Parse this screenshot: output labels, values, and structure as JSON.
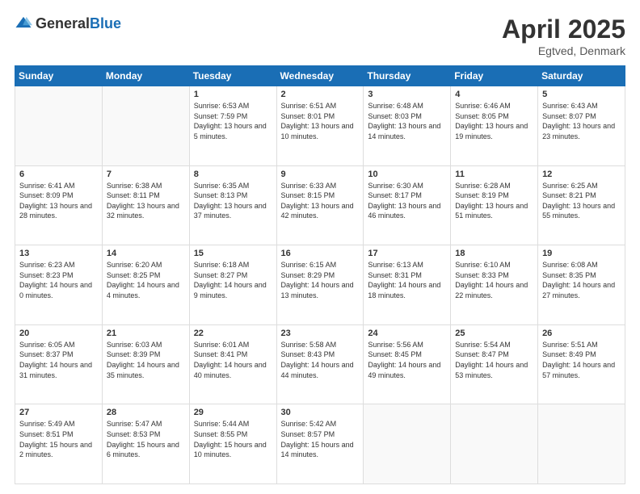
{
  "header": {
    "logo_general": "General",
    "logo_blue": "Blue",
    "title": "April 2025",
    "location": "Egtved, Denmark"
  },
  "days_of_week": [
    "Sunday",
    "Monday",
    "Tuesday",
    "Wednesday",
    "Thursday",
    "Friday",
    "Saturday"
  ],
  "weeks": [
    [
      {
        "num": "",
        "info": ""
      },
      {
        "num": "",
        "info": ""
      },
      {
        "num": "1",
        "info": "Sunrise: 6:53 AM\nSunset: 7:59 PM\nDaylight: 13 hours and 5 minutes."
      },
      {
        "num": "2",
        "info": "Sunrise: 6:51 AM\nSunset: 8:01 PM\nDaylight: 13 hours and 10 minutes."
      },
      {
        "num": "3",
        "info": "Sunrise: 6:48 AM\nSunset: 8:03 PM\nDaylight: 13 hours and 14 minutes."
      },
      {
        "num": "4",
        "info": "Sunrise: 6:46 AM\nSunset: 8:05 PM\nDaylight: 13 hours and 19 minutes."
      },
      {
        "num": "5",
        "info": "Sunrise: 6:43 AM\nSunset: 8:07 PM\nDaylight: 13 hours and 23 minutes."
      }
    ],
    [
      {
        "num": "6",
        "info": "Sunrise: 6:41 AM\nSunset: 8:09 PM\nDaylight: 13 hours and 28 minutes."
      },
      {
        "num": "7",
        "info": "Sunrise: 6:38 AM\nSunset: 8:11 PM\nDaylight: 13 hours and 32 minutes."
      },
      {
        "num": "8",
        "info": "Sunrise: 6:35 AM\nSunset: 8:13 PM\nDaylight: 13 hours and 37 minutes."
      },
      {
        "num": "9",
        "info": "Sunrise: 6:33 AM\nSunset: 8:15 PM\nDaylight: 13 hours and 42 minutes."
      },
      {
        "num": "10",
        "info": "Sunrise: 6:30 AM\nSunset: 8:17 PM\nDaylight: 13 hours and 46 minutes."
      },
      {
        "num": "11",
        "info": "Sunrise: 6:28 AM\nSunset: 8:19 PM\nDaylight: 13 hours and 51 minutes."
      },
      {
        "num": "12",
        "info": "Sunrise: 6:25 AM\nSunset: 8:21 PM\nDaylight: 13 hours and 55 minutes."
      }
    ],
    [
      {
        "num": "13",
        "info": "Sunrise: 6:23 AM\nSunset: 8:23 PM\nDaylight: 14 hours and 0 minutes."
      },
      {
        "num": "14",
        "info": "Sunrise: 6:20 AM\nSunset: 8:25 PM\nDaylight: 14 hours and 4 minutes."
      },
      {
        "num": "15",
        "info": "Sunrise: 6:18 AM\nSunset: 8:27 PM\nDaylight: 14 hours and 9 minutes."
      },
      {
        "num": "16",
        "info": "Sunrise: 6:15 AM\nSunset: 8:29 PM\nDaylight: 14 hours and 13 minutes."
      },
      {
        "num": "17",
        "info": "Sunrise: 6:13 AM\nSunset: 8:31 PM\nDaylight: 14 hours and 18 minutes."
      },
      {
        "num": "18",
        "info": "Sunrise: 6:10 AM\nSunset: 8:33 PM\nDaylight: 14 hours and 22 minutes."
      },
      {
        "num": "19",
        "info": "Sunrise: 6:08 AM\nSunset: 8:35 PM\nDaylight: 14 hours and 27 minutes."
      }
    ],
    [
      {
        "num": "20",
        "info": "Sunrise: 6:05 AM\nSunset: 8:37 PM\nDaylight: 14 hours and 31 minutes."
      },
      {
        "num": "21",
        "info": "Sunrise: 6:03 AM\nSunset: 8:39 PM\nDaylight: 14 hours and 35 minutes."
      },
      {
        "num": "22",
        "info": "Sunrise: 6:01 AM\nSunset: 8:41 PM\nDaylight: 14 hours and 40 minutes."
      },
      {
        "num": "23",
        "info": "Sunrise: 5:58 AM\nSunset: 8:43 PM\nDaylight: 14 hours and 44 minutes."
      },
      {
        "num": "24",
        "info": "Sunrise: 5:56 AM\nSunset: 8:45 PM\nDaylight: 14 hours and 49 minutes."
      },
      {
        "num": "25",
        "info": "Sunrise: 5:54 AM\nSunset: 8:47 PM\nDaylight: 14 hours and 53 minutes."
      },
      {
        "num": "26",
        "info": "Sunrise: 5:51 AM\nSunset: 8:49 PM\nDaylight: 14 hours and 57 minutes."
      }
    ],
    [
      {
        "num": "27",
        "info": "Sunrise: 5:49 AM\nSunset: 8:51 PM\nDaylight: 15 hours and 2 minutes."
      },
      {
        "num": "28",
        "info": "Sunrise: 5:47 AM\nSunset: 8:53 PM\nDaylight: 15 hours and 6 minutes."
      },
      {
        "num": "29",
        "info": "Sunrise: 5:44 AM\nSunset: 8:55 PM\nDaylight: 15 hours and 10 minutes."
      },
      {
        "num": "30",
        "info": "Sunrise: 5:42 AM\nSunset: 8:57 PM\nDaylight: 15 hours and 14 minutes."
      },
      {
        "num": "",
        "info": ""
      },
      {
        "num": "",
        "info": ""
      },
      {
        "num": "",
        "info": ""
      }
    ]
  ]
}
